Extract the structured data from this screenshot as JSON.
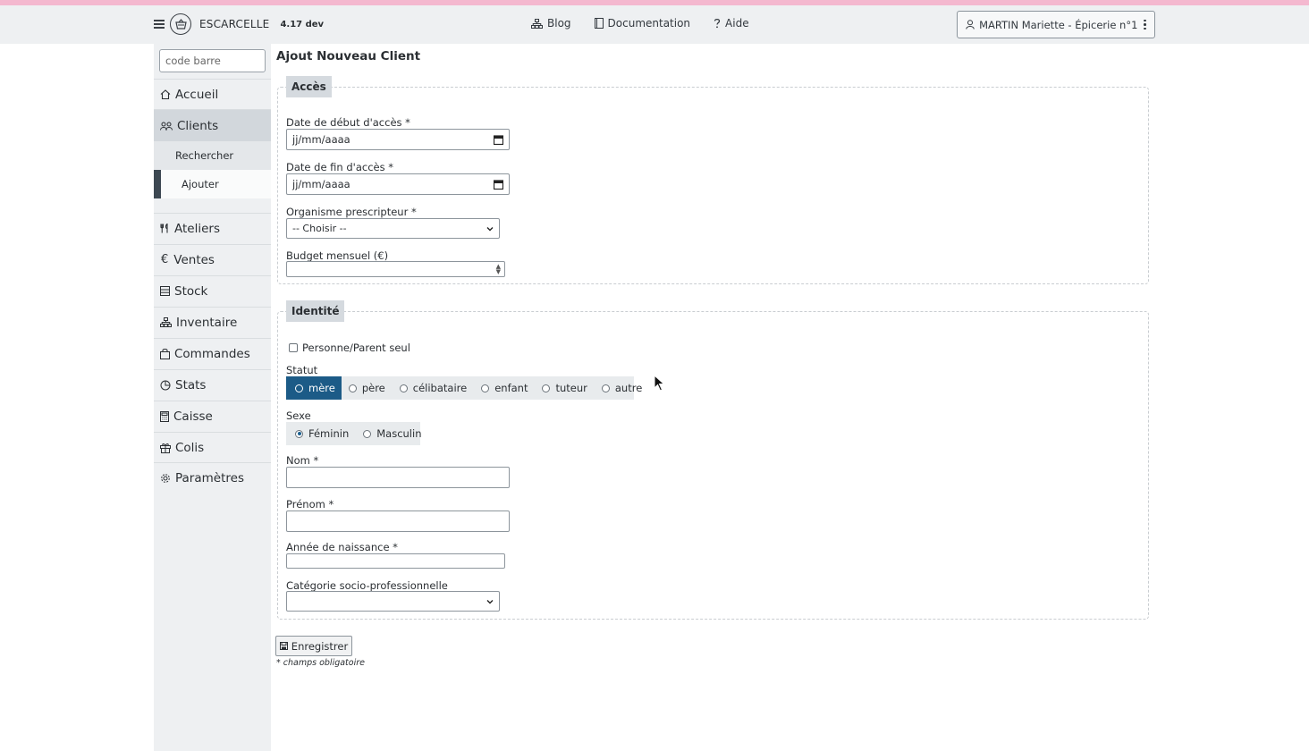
{
  "header": {
    "brand": "ESCARCELLE",
    "version": "4.17 dev",
    "nav": [
      {
        "label": "Blog",
        "icon": "sitemap-icon"
      },
      {
        "label": "Documentation",
        "icon": "book-icon"
      },
      {
        "label": "Aide",
        "icon": "question-icon"
      }
    ],
    "user_label": "MARTIN Mariette - Épicerie n°1"
  },
  "sidebar": {
    "barcode_placeholder": "code barre",
    "items": [
      {
        "label": "Accueil",
        "icon": "home-icon"
      },
      {
        "label": "Clients",
        "icon": "users-icon",
        "active": true
      },
      {
        "label": "Ateliers",
        "icon": "utensils-icon"
      },
      {
        "label": "Ventes",
        "icon": "euro-icon"
      },
      {
        "label": "Stock",
        "icon": "stock-icon"
      },
      {
        "label": "Inventaire",
        "icon": "sitemap-icon"
      },
      {
        "label": "Commandes",
        "icon": "bag-icon"
      },
      {
        "label": "Stats",
        "icon": "chart-icon"
      },
      {
        "label": "Caisse",
        "icon": "calculator-icon"
      },
      {
        "label": "Colis",
        "icon": "gift-icon"
      },
      {
        "label": "Paramètres",
        "icon": "gear-icon"
      }
    ],
    "subitems": [
      {
        "label": "Rechercher"
      },
      {
        "label": "Ajouter",
        "current": true
      }
    ]
  },
  "page": {
    "title": "Ajout Nouveau Client"
  },
  "acces": {
    "legend": "Accès",
    "date_debut_label": "Date de début d'accès *",
    "date_debut_value": "jj/mm/aaaa",
    "date_fin_label": "Date de fin d'accès *",
    "date_fin_value": "jj/mm/aaaa",
    "organisme_label": "Organisme prescripteur *",
    "organisme_value": "-- Choisir --",
    "budget_label": "Budget mensuel (€)",
    "budget_value": ""
  },
  "identite": {
    "legend": "Identité",
    "parent_seul_label": "Personne/Parent seul",
    "parent_seul_checked": false,
    "statut_label": "Statut",
    "statut_options": [
      "mère",
      "père",
      "célibataire",
      "enfant",
      "tuteur",
      "autre"
    ],
    "statut_selected": "mère",
    "sexe_label": "Sexe",
    "sexe_options": [
      "Féminin",
      "Masculin"
    ],
    "sexe_selected": "Féminin",
    "nom_label": "Nom *",
    "nom_value": "",
    "prenom_label": "Prénom *",
    "prenom_value": "",
    "annee_label": "Année de naissance *",
    "annee_value": "",
    "categorie_label": "Catégorie socio-professionnelle",
    "categorie_value": ""
  },
  "actions": {
    "save_label": "Enregistrer",
    "footnote": "* champs obligatoire"
  }
}
